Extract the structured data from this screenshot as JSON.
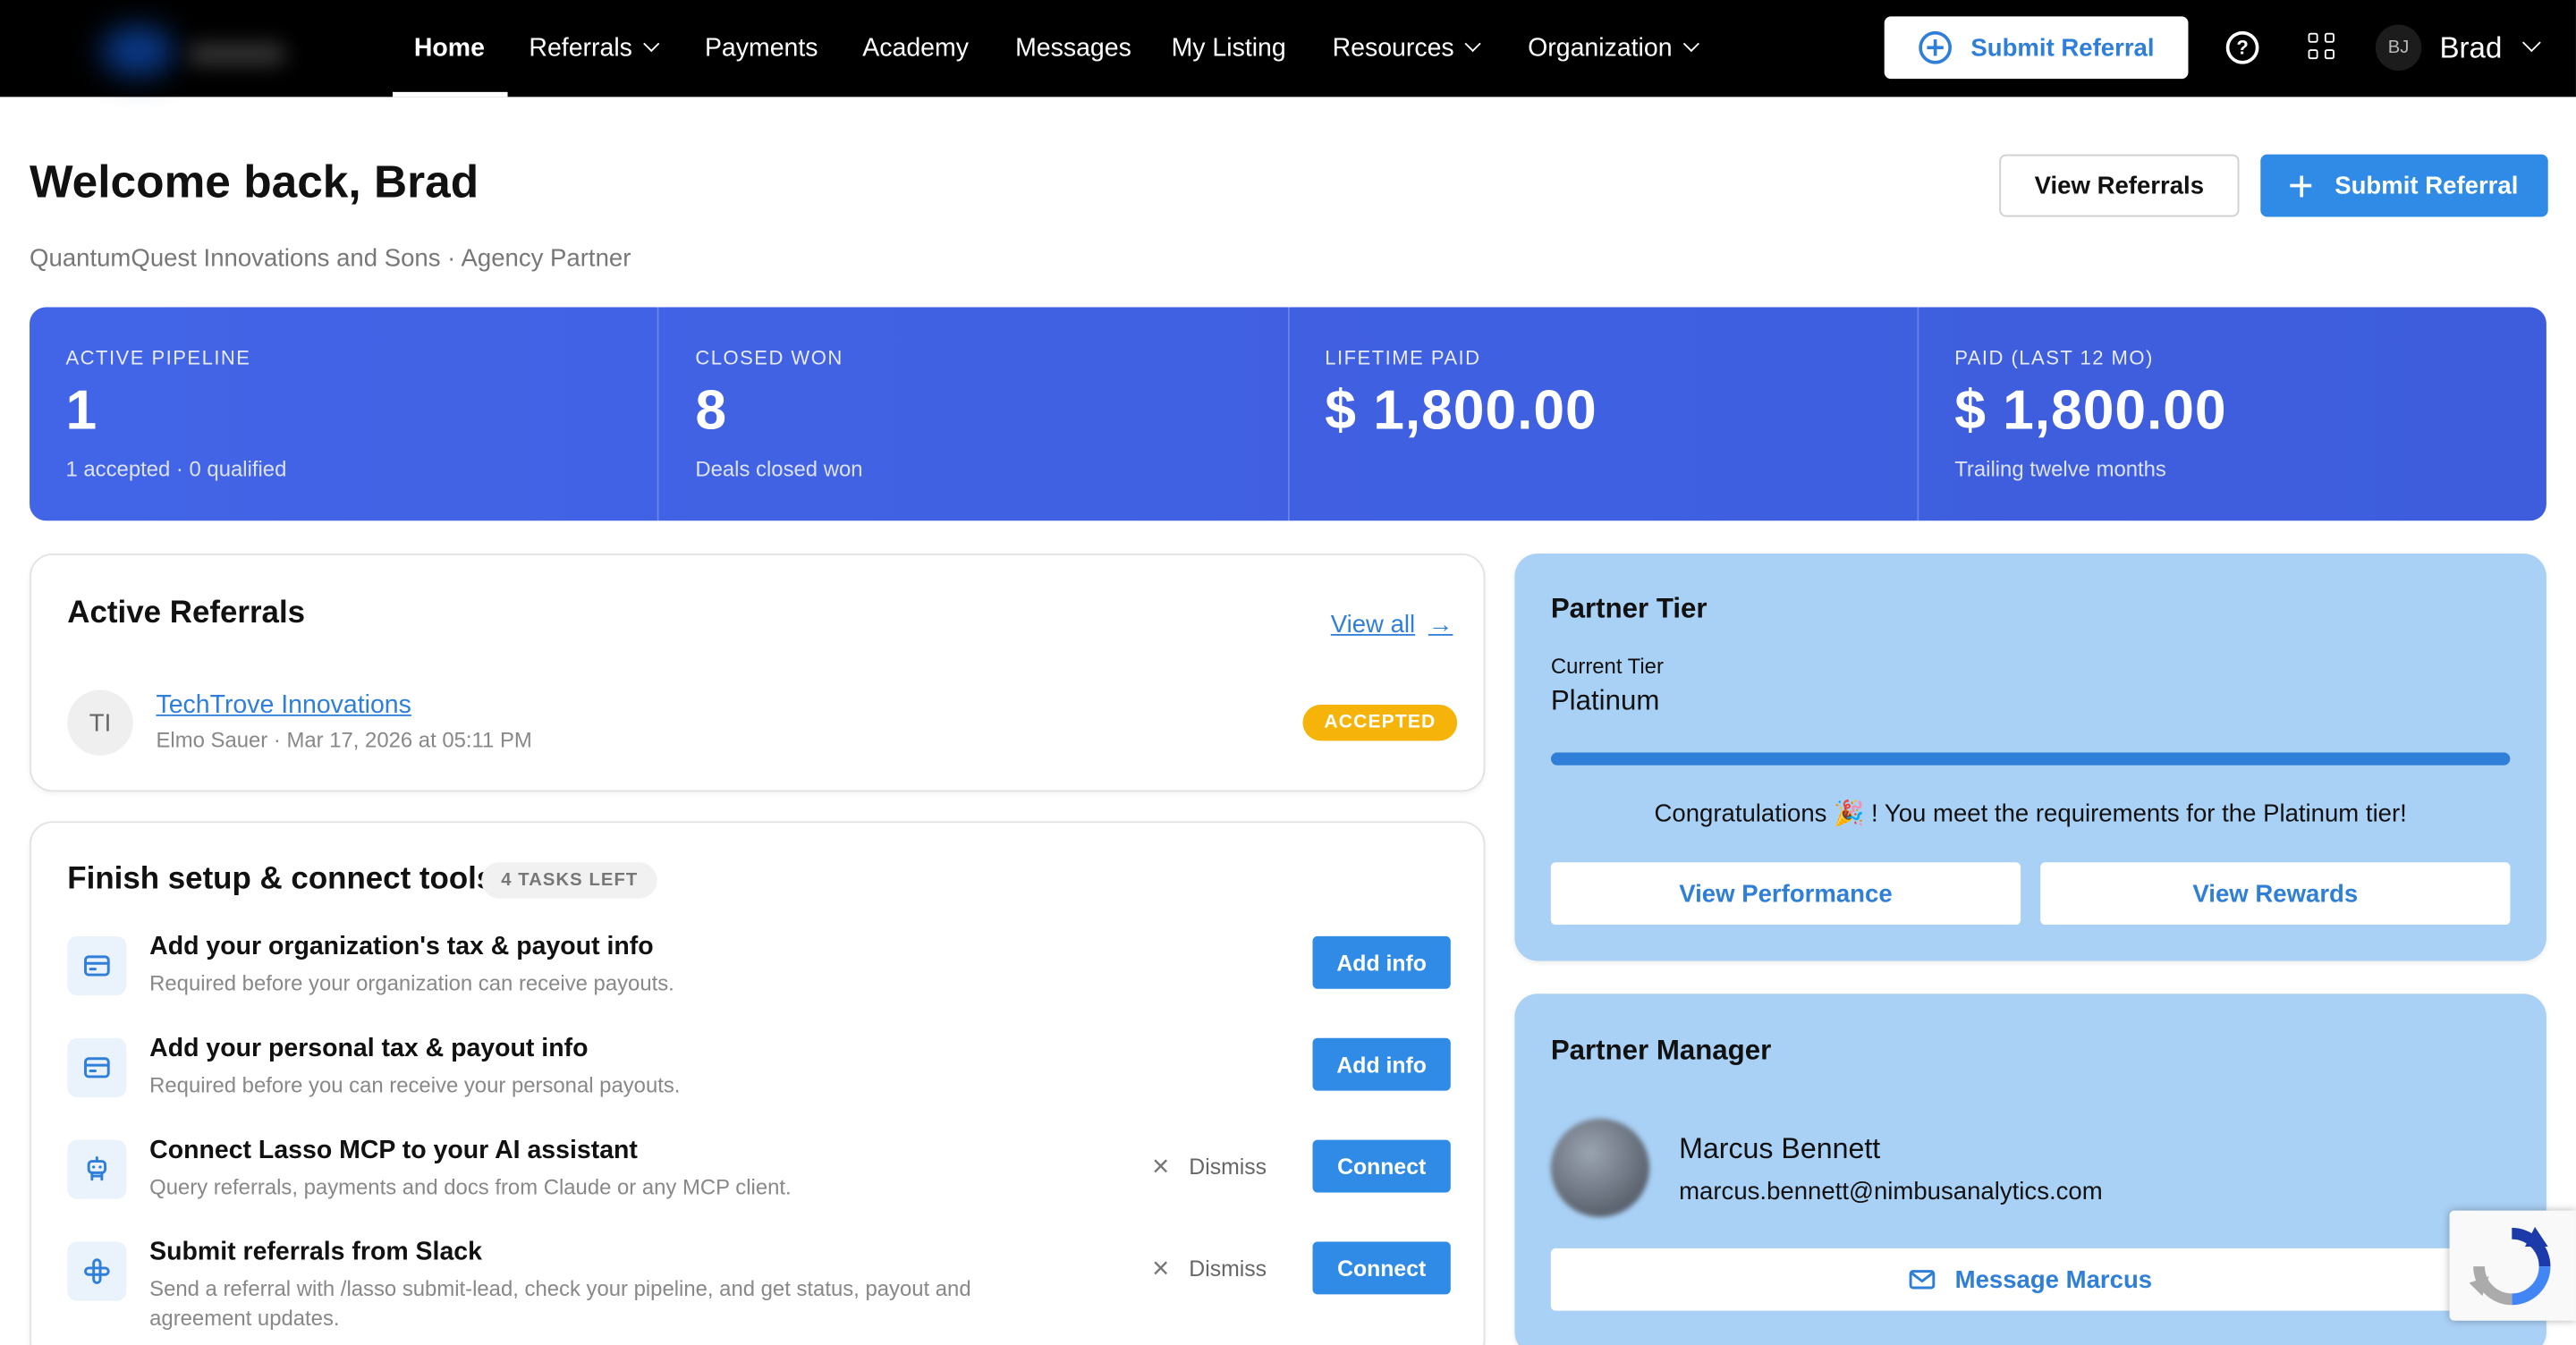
{
  "nav": {
    "items": [
      {
        "label": "Home",
        "active": true
      },
      {
        "label": "Referrals",
        "dropdown": true
      },
      {
        "label": "Payments"
      },
      {
        "label": "Academy"
      },
      {
        "label": "Messages"
      },
      {
        "label": "My Listing"
      },
      {
        "label": "Resources",
        "dropdown": true
      },
      {
        "label": "Organization",
        "dropdown": true
      }
    ],
    "submit_label": "Submit Referral",
    "user_initials": "BJ",
    "user_name": "Brad"
  },
  "header": {
    "title": "Welcome back, Brad",
    "subtitle": "QuantumQuest Innovations and Sons · Agency Partner",
    "view_referrals": "View Referrals",
    "submit_referral": "Submit Referral"
  },
  "stats": [
    {
      "label": "ACTIVE PIPELINE",
      "value": "1",
      "sub": "1 accepted · 0 qualified"
    },
    {
      "label": "CLOSED WON",
      "value": "8",
      "sub": "Deals closed won"
    },
    {
      "label": "LIFETIME PAID",
      "value": "$ 1,800.00",
      "sub": ""
    },
    {
      "label": "PAID (LAST 12 MO)",
      "value": "$ 1,800.00",
      "sub": "Trailing twelve months"
    }
  ],
  "active_referrals": {
    "title": "Active Referrals",
    "view_all": "View all",
    "items": [
      {
        "initials": "TI",
        "name": "TechTrove Innovations",
        "meta": "Elmo Sauer · Mar 17, 2026 at 05:11 PM",
        "status": "ACCEPTED"
      }
    ]
  },
  "setup": {
    "title": "Finish setup & connect tools",
    "badge": "4 TASKS LEFT",
    "dismiss_label": "Dismiss",
    "tasks": [
      {
        "icon": "credit-card-icon",
        "title": "Add your organization's tax & payout info",
        "desc": "Required before your organization can receive payouts.",
        "action": "Add info",
        "dismissable": false
      },
      {
        "icon": "credit-card-icon",
        "title": "Add your personal tax & payout info",
        "desc": "Required before you can receive your personal payouts.",
        "action": "Add info",
        "dismissable": false
      },
      {
        "icon": "robot-icon",
        "title": "Connect Lasso MCP to your AI assistant",
        "desc": "Query referrals, payments and docs from Claude or any MCP client.",
        "action": "Connect",
        "dismissable": true
      },
      {
        "icon": "slack-icon",
        "title": "Submit referrals from Slack",
        "desc": "Send a referral with /lasso submit-lead, check your pipeline, and get status, payout and agreement updates.",
        "action": "Connect",
        "dismissable": true
      }
    ]
  },
  "partner_tier": {
    "title": "Partner Tier",
    "current_label": "Current Tier",
    "tier": "Platinum",
    "progress": 1.0,
    "message": "Congratulations 🎉 ! You meet the requirements for the Platinum tier!",
    "view_performance": "View Performance",
    "view_rewards": "View Rewards"
  },
  "partner_manager": {
    "title": "Partner Manager",
    "name": "Marcus Bennett",
    "email": "marcus.bennett@nimbusanalytics.com",
    "message_btn": "Message Marcus"
  },
  "colors": {
    "accent": "#2f8be6",
    "stats_bg": "#4264e6",
    "badge_accepted": "#f6b40b",
    "right_card_bg": "#a9d0f5"
  }
}
